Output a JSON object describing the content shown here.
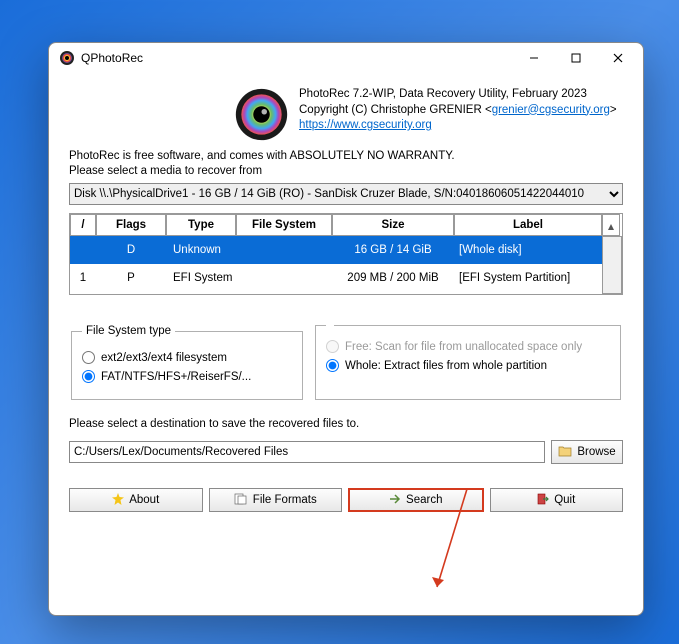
{
  "window": {
    "title": "QPhotoRec"
  },
  "header": {
    "line1": "PhotoRec 7.2-WIP, Data Recovery Utility, February 2023",
    "line2_a": "Copyright (C) Christophe GRENIER <",
    "line2_email": "grenier@cgsecurity.org",
    "line2_b": ">",
    "link": "https://www.cgsecurity.org"
  },
  "intro": {
    "warranty": "PhotoRec is free software, and comes with ABSOLUTELY NO WARRANTY.",
    "select_media": "Please select a media to recover from"
  },
  "media": {
    "selected": "Disk \\\\.\\PhysicalDrive1 - 16 GB / 14 GiB (RO) - SanDisk Cruzer Blade, S/N:04018606051422044010"
  },
  "table": {
    "headers": {
      "c0": "/",
      "c1": "Flags",
      "c2": "Type",
      "c3": "File System",
      "c4": "Size",
      "c5": "Label"
    },
    "rows": [
      {
        "c0": "",
        "c1": "D",
        "c2": "Unknown",
        "c3": "",
        "c4": "16 GB / 14 GiB",
        "c5": "[Whole disk]",
        "selected": true
      },
      {
        "c0": "1",
        "c1": "P",
        "c2": "EFI System",
        "c3": "",
        "c4": "209 MB / 200 MiB",
        "c5": "[EFI System Partition]",
        "selected": false
      }
    ]
  },
  "fs": {
    "legend": "File System type",
    "opt1": "ext2/ext3/ext4 filesystem",
    "opt2": "FAT/NTFS/HFS+/ReiserFS/..."
  },
  "mode": {
    "opt1": "Free: Scan for file from unallocated space only",
    "opt2": "Whole: Extract files from whole partition"
  },
  "dest": {
    "label": "Please select a destination to save the recovered files to.",
    "value": "C:/Users/Lex/Documents/Recovered Files",
    "browse": "Browse"
  },
  "buttons": {
    "about": "About",
    "formats": "File Formats",
    "search": "Search",
    "quit": "Quit"
  },
  "colors": {
    "accent": "#0a6cd6",
    "highlight": "#d43a1e"
  }
}
